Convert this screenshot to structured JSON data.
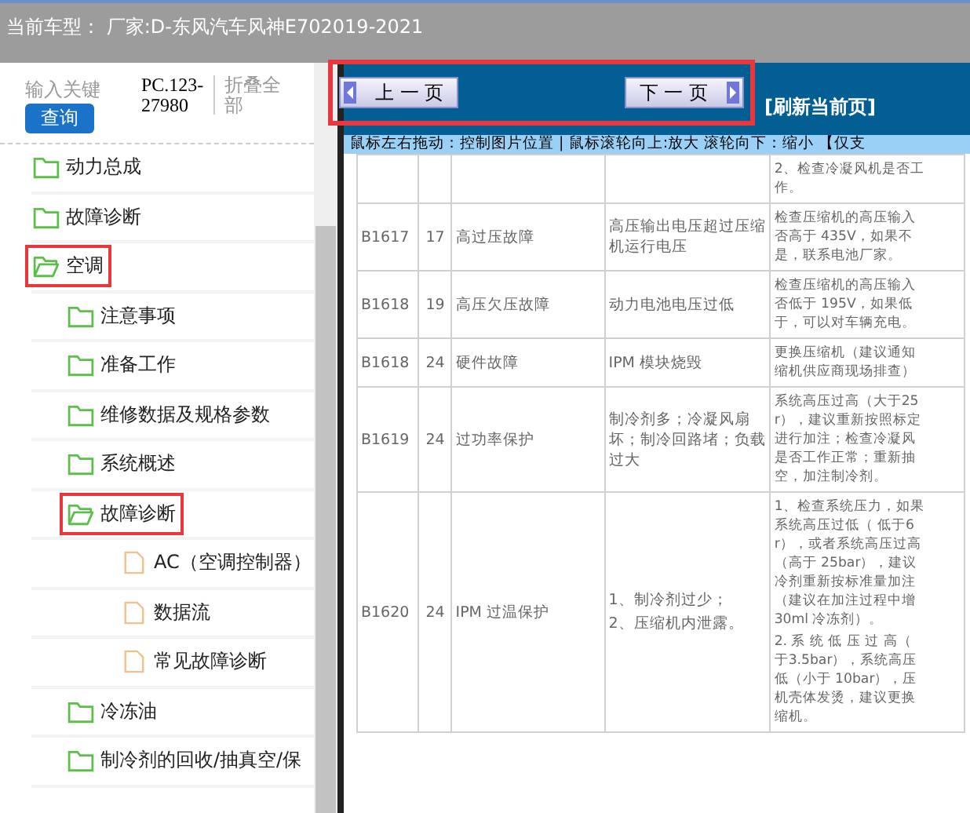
{
  "header": {
    "title": "当前车型：  厂家:D-东风汽车风神E702019-2021"
  },
  "sidebar": {
    "search": {
      "placeholder": "输入关键",
      "button": "查询"
    },
    "code": "PC.123-27980",
    "collapse_all": "折叠全部",
    "tree": [
      {
        "label": "动力总成",
        "kind": "folder",
        "expanded": false,
        "highlighted": false
      },
      {
        "label": "故障诊断",
        "kind": "folder",
        "expanded": false,
        "highlighted": false
      },
      {
        "label": "空调",
        "kind": "folder",
        "expanded": true,
        "highlighted": true,
        "children": [
          {
            "label": "注意事项",
            "kind": "folder",
            "expanded": false,
            "highlighted": false
          },
          {
            "label": "准备工作",
            "kind": "folder",
            "expanded": false,
            "highlighted": false
          },
          {
            "label": "维修数据及规格参数",
            "kind": "folder",
            "expanded": false,
            "highlighted": false
          },
          {
            "label": "系统概述",
            "kind": "folder",
            "expanded": false,
            "highlighted": false
          },
          {
            "label": "故障诊断",
            "kind": "folder",
            "expanded": true,
            "highlighted": true,
            "children": [
              {
                "label": "AC（空调控制器）",
                "kind": "doc",
                "highlighted": false
              },
              {
                "label": "数据流",
                "kind": "doc",
                "highlighted": false
              },
              {
                "label": "常见故障诊断",
                "kind": "doc",
                "highlighted": false
              }
            ]
          },
          {
            "label": "冷冻油",
            "kind": "folder",
            "expanded": false,
            "highlighted": false
          },
          {
            "label": "制冷剂的回收/抽真空/保",
            "kind": "folder",
            "expanded": false,
            "highlighted": false
          }
        ]
      }
    ]
  },
  "viewer": {
    "nav": {
      "prev": "上 一 页",
      "next": "下 一 页",
      "refresh": "[刷新当前页]",
      "highlighted": true
    },
    "tip": "鼠标左右拖动：控制图片位置 | 鼠标滚轮向上:放大  滚轮向下：缩小 【仅支",
    "table": {
      "rows": [
        {
          "code": "",
          "num": "",
          "name": "",
          "cause": [],
          "solution": [
            [
              "2、检查冷凝风机是否工",
              "作。"
            ]
          ]
        },
        {
          "code": "B1617",
          "num": "17",
          "name": "高过压故障",
          "cause": [
            "高压输出电压超过压缩机运行电压"
          ],
          "solution": [
            [
              "检查压缩机的高压输入",
              "否高于 435V，如果不",
              "是，联系电池厂家。"
            ]
          ]
        },
        {
          "code": "B1618",
          "num": "19",
          "name": "高压欠压故障",
          "cause": [
            "动力电池电压过低"
          ],
          "solution": [
            [
              "检查压缩机的高压输入",
              "否低于 195V，如果低",
              "于，可以对车辆充电。"
            ]
          ]
        },
        {
          "code": "B1618",
          "num": "24",
          "name": "硬件故障",
          "cause": [
            "IPM 模块烧毁"
          ],
          "solution": [
            [
              "更换压缩机（建议通知",
              "缩机供应商现场排查）"
            ]
          ]
        },
        {
          "code": "B1619",
          "num": "24",
          "name": "过功率保护",
          "cause": [
            "制冷剂多；冷凝风扇坏；制冷回路堵；负载过大"
          ],
          "solution": [
            [
              "系统高压过高（大于25",
              "r），建议重新按照标定",
              "进行加注；检查冷凝风",
              "是否工作正常；重新抽",
              "空，加注制冷剂。"
            ]
          ]
        },
        {
          "code": "B1620",
          "num": "24",
          "name": "IPM 过温保护",
          "cause": [
            "1、制冷剂过少；",
            "2、压缩机内泄露。"
          ],
          "solution": [
            [
              "1、检查系统压力，如果",
              "系统高压过低（ 低于6",
              "r），或者系统高压过高",
              "（高于 25bar），建议",
              "冷剂重新按标准量加注",
              "（建议在加注过程中增",
              "30ml 冷冻剂）。"
            ],
            [
              "2. 系 统 低 压 过 高（",
              "于3.5bar），系统高压",
              "低（小于 10bar），压",
              "机壳体发烫，建议更换",
              "缩机。"
            ]
          ]
        }
      ]
    }
  }
}
